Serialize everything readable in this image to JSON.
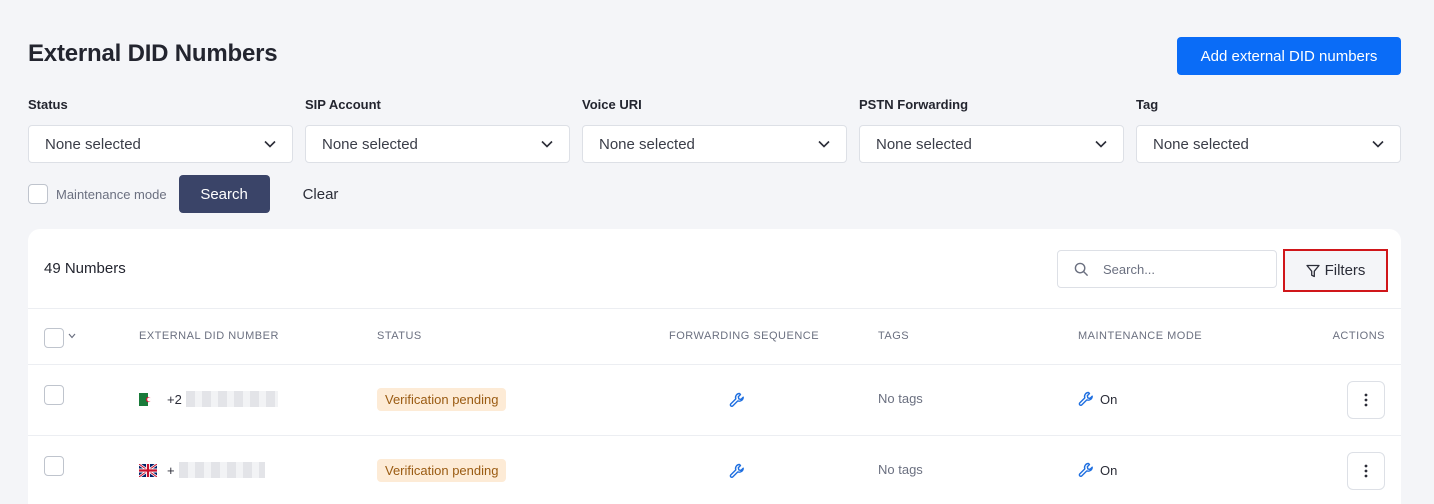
{
  "header": {
    "title": "External DID Numbers",
    "add_button_label": "Add external DID numbers"
  },
  "filters": [
    {
      "label": "Status",
      "value": "None selected"
    },
    {
      "label": "SIP Account",
      "value": "None selected"
    },
    {
      "label": "Voice URI",
      "value": "None selected"
    },
    {
      "label": "PSTN Forwarding",
      "value": "None selected"
    },
    {
      "label": "Tag",
      "value": "None selected"
    }
  ],
  "maintenance_filter": {
    "label": "Maintenance mode",
    "checked": false,
    "search_label": "Search",
    "clear_label": "Clear"
  },
  "table": {
    "count_label": "49 Numbers",
    "search_placeholder": "Search...",
    "filters_label": "Filters",
    "columns": [
      "EXTERNAL DID NUMBER",
      "STATUS",
      "FORWARDING SEQUENCE",
      "TAGS",
      "MAINTENANCE MODE",
      "ACTIONS"
    ],
    "rows": [
      {
        "flag": "algeria-flag",
        "number_visible": "+2",
        "status": "Verification pending",
        "forwarding_icon": "wrench-icon",
        "tags": "No tags",
        "maintenance": "On"
      },
      {
        "flag": "uk-flag",
        "number_visible": "+",
        "status": "Verification pending",
        "forwarding_icon": "wrench-icon",
        "tags": "No tags",
        "maintenance": "On"
      }
    ]
  },
  "colors": {
    "primary": "#0a6cf7",
    "search_button": "#3a4468",
    "badge_bg": "#fdebd6",
    "badge_text": "#9a5b12",
    "highlight_border": "#d0161a",
    "icon_blue": "#1f6fe0"
  }
}
